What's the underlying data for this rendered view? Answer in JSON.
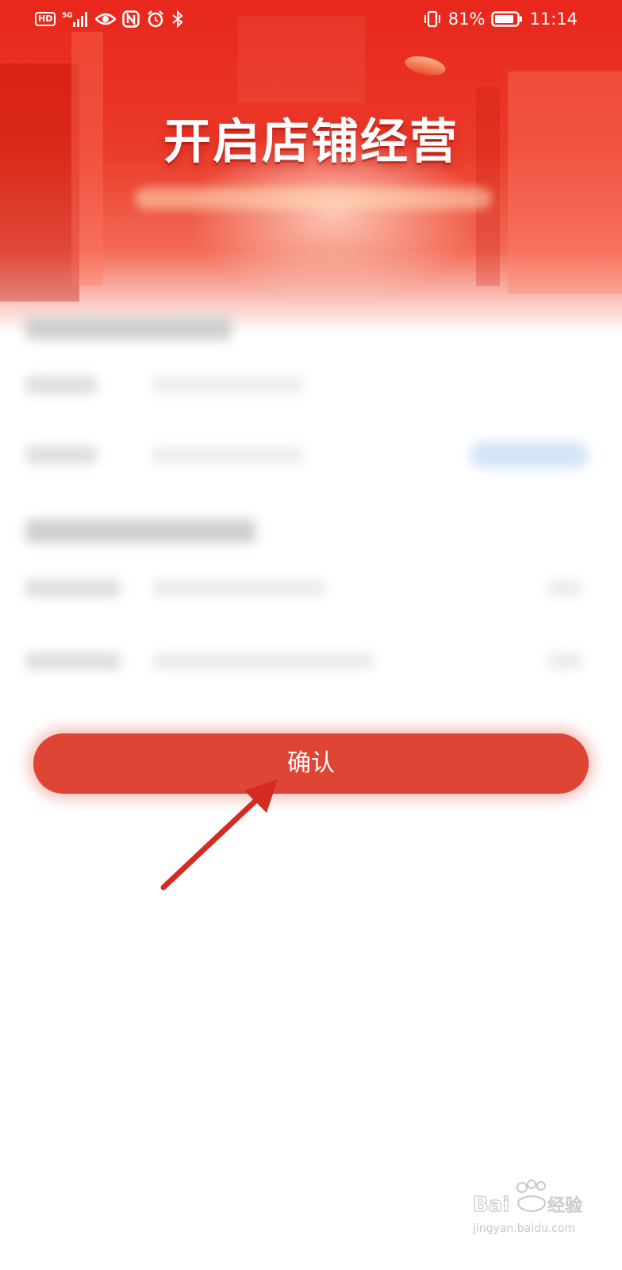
{
  "status_bar": {
    "left_badges": {
      "hd": "HD",
      "network": "5G"
    },
    "left_icons": [
      "signal-icon",
      "eye-icon",
      "nfc-icon",
      "alarm-icon",
      "bluetooth-icon"
    ],
    "battery_percent": "81%",
    "time": "11:14",
    "right_icons": [
      "vibrate-icon",
      "battery-icon"
    ]
  },
  "hero": {
    "title": "开启店铺经营"
  },
  "form": {
    "blurred": true
  },
  "actions": {
    "confirm_label": "确认"
  },
  "colors": {
    "brand_red": "#e8271b",
    "button_red": "#de4535",
    "annotation_arrow": "#d42b22"
  },
  "watermark": {
    "brand": "Baidu经验"
  }
}
